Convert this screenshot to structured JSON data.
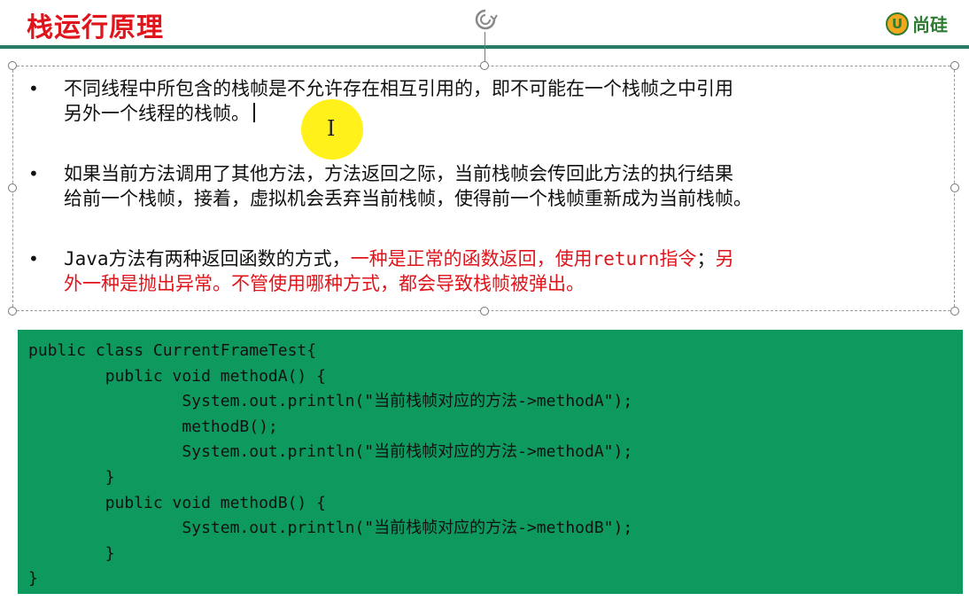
{
  "slide": {
    "title": "栈运行原理",
    "brand_mark": "U",
    "brand_text": "尚硅"
  },
  "bullets": [
    {
      "line1": "不同线程中所包含的栈帧是不允许存在相互引用的，即不可能在一个栈帧之中引用",
      "line2": "另外一个线程的栈帧。"
    },
    {
      "line1": "如果当前方法调用了其他方法，方法返回之际，当前栈帧会传回此方法的执行结果",
      "line2": "给前一个栈帧，接着，虚拟机会丢弃当前栈帧，使得前一个栈帧重新成为当前栈帧。"
    },
    {
      "java": "Java",
      "a": "方法有两种返回函数的方式，",
      "red1": "一种是正常的函数返回，使用",
      "return_kw": "return",
      "red2": "指令",
      "semi": "；",
      "red3": "另",
      "line2": "外一种是抛出异常。不管使用哪种方式，都会导致栈帧被弹出。"
    }
  ],
  "code": [
    "public class CurrentFrameTest{",
    "        public void methodA() {",
    "                System.out.println(\"当前栈帧对应的方法->methodA\");",
    "                methodB();",
    "                System.out.println(\"当前栈帧对应的方法->methodA\");",
    "        }",
    "        public void methodB() {",
    "                System.out.println(\"当前栈帧对应的方法->methodB\");",
    "        }",
    "}"
  ],
  "colors": {
    "title_red": "#e0151b",
    "rule_teal": "#2a7a66",
    "code_bg": "#0e9a5f",
    "cursor_highlight": "#ffef00"
  },
  "icons": {
    "rotate": "rotate-handle-icon",
    "cursor": "ibeam-cursor-icon"
  }
}
